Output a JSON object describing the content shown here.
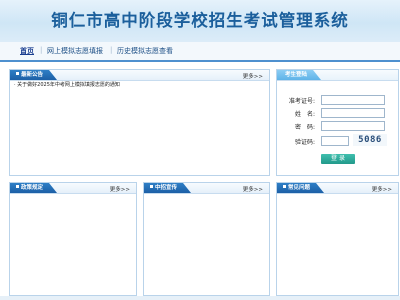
{
  "header": {
    "title": "铜仁市高中阶段学校招生考试管理系统"
  },
  "nav": {
    "items": [
      {
        "label": "首页"
      },
      {
        "label": "网上模拟志愿填报"
      },
      {
        "label": "历史模拟志愿查看"
      }
    ]
  },
  "announcements": {
    "title": "最新公告",
    "more": "更多>>",
    "items": [
      "· 关于做好2025年中考网上模拟填报志愿的通知"
    ]
  },
  "login": {
    "title": "考生登陆",
    "exam_id_label": "准考证号:",
    "name_label": "姓　名:",
    "password_label": "密　码:",
    "captcha_label": "验证码:",
    "captcha_code": "5086",
    "login_button": "登 录"
  },
  "policy": {
    "title": "政策规定",
    "more": "更多>>"
  },
  "promotion": {
    "title": "中招宣传",
    "more": "更多>>"
  },
  "faq": {
    "title": "常见问题",
    "more": "更多>>"
  }
}
